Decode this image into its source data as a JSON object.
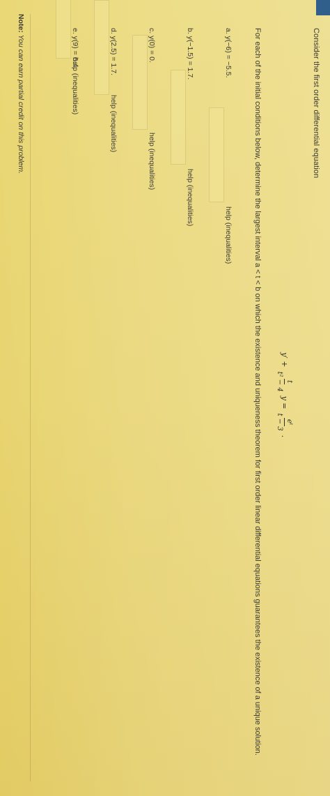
{
  "problem": {
    "intro": "Consider the first order differential equation",
    "equation": {
      "lhs_a": "y′ +",
      "coef_num": "t",
      "coef_den": "t² − 4",
      "lhs_b": "y =",
      "rhs_num": "eᵗ",
      "rhs_den": "t − 3",
      "end": "."
    },
    "instructions": "For each of the initial conditions below, determine the largest interval a < t < b on which the existence and uniqueness theorem for first order linear differential equations guarantees the existence of a unique solution.",
    "parts": [
      {
        "label": "a. y(−6) = −5.5.",
        "help": "help (inequalities)",
        "value": ""
      },
      {
        "label": "b. y(−1.5) = 1.7.",
        "help": "help (inequalities)",
        "value": ""
      },
      {
        "label": "c. y(0) = 0.",
        "help": "help (inequalities)",
        "value": ""
      },
      {
        "label": "d. y(2.5) = 1.7.",
        "help": "help (inequalities)",
        "value": ""
      },
      {
        "label": "e. y(9) = 6.4.",
        "help": "help (inequalities)",
        "value": ""
      }
    ],
    "note_label": "Note:",
    "note_text": " You can earn partial credit on this problem."
  },
  "colors": {
    "paper": "#e7d36c",
    "text": "#3b3a36",
    "tab": "#2f5f8a"
  }
}
